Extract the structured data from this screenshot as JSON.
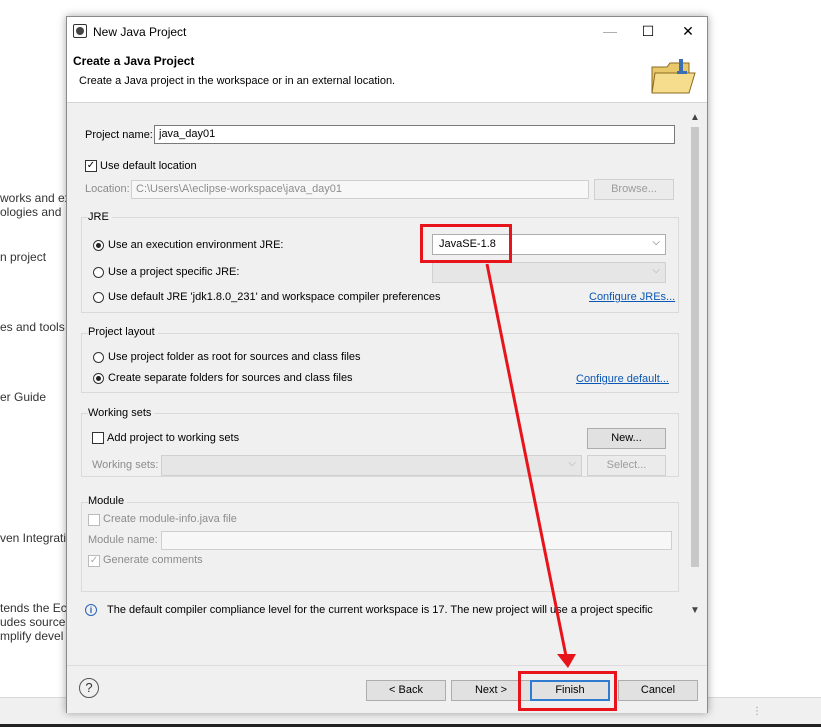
{
  "background": {
    "lines": [
      "works and ex",
      "ologies and",
      "n project",
      "es and tools",
      "er Guide",
      "ven Integrati",
      "tends the Ec",
      "udes source",
      "mplify devel"
    ]
  },
  "dialog": {
    "title": "New Java Project",
    "header_title": "Create a Java Project",
    "header_desc": "Create a Java project in the workspace or in an external location.",
    "win_minimize": "—",
    "win_maximize": "☐",
    "win_close": "✕"
  },
  "project": {
    "name_label": "Project name:",
    "name_value": "java_day01",
    "use_default_location": "Use default location",
    "location_label": "Location:",
    "location_value": "C:\\Users\\A\\eclipse-workspace\\java_day01",
    "browse_label": "Browse..."
  },
  "jre": {
    "group_title": "JRE",
    "option_env": "Use an execution environment JRE:",
    "env_value": "JavaSE-1.8",
    "option_specific": "Use a project specific JRE:",
    "option_default": "Use default JRE 'jdk1.8.0_231' and workspace compiler preferences",
    "configure_link": "Configure JREs..."
  },
  "layout": {
    "group_title": "Project layout",
    "option_root": "Use project folder as root for sources and class files",
    "option_separate": "Create separate folders for sources and class files",
    "configure_link": "Configure default..."
  },
  "working_sets": {
    "group_title": "Working sets",
    "add_label": "Add project to working sets",
    "new_button": "New...",
    "sets_label": "Working sets:",
    "select_button": "Select..."
  },
  "module": {
    "group_title": "Module",
    "create_label": "Create module-info.java file",
    "name_label": "Module name:",
    "generate_label": "Generate comments"
  },
  "info_message": "The default compiler compliance level for the current workspace is 17. The new project will use a project specific",
  "footer": {
    "help": "?",
    "back": "< Back",
    "next": "Next >",
    "finish": "Finish",
    "cancel": "Cancel"
  },
  "colors": {
    "annotation": "#e8141b",
    "link": "#0b57b5",
    "primary_border": "#2f7bd0"
  }
}
